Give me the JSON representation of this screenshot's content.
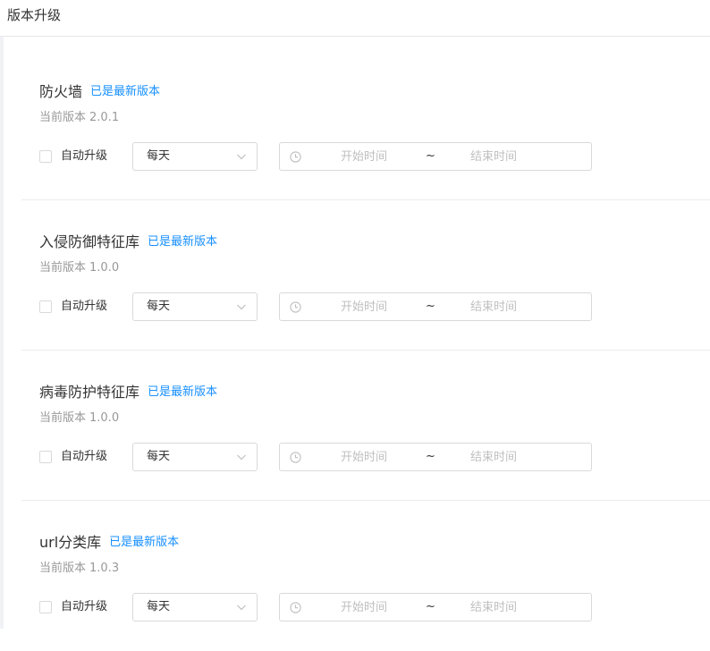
{
  "page": {
    "title": "版本升级"
  },
  "sections": [
    {
      "title": "防火墙",
      "status": "已是最新版本",
      "version_label": "当前版本",
      "version": "2.0.1",
      "auto_upgrade_label": "自动升级",
      "frequency": "每天",
      "start_placeholder": "开始时间",
      "separator": "~",
      "end_placeholder": "结束时间"
    },
    {
      "title": "入侵防御特征库",
      "status": "已是最新版本",
      "version_label": "当前版本",
      "version": "1.0.0",
      "auto_upgrade_label": "自动升级",
      "frequency": "每天",
      "start_placeholder": "开始时间",
      "separator": "~",
      "end_placeholder": "结束时间"
    },
    {
      "title": "病毒防护特征库",
      "status": "已是最新版本",
      "version_label": "当前版本",
      "version": "1.0.0",
      "auto_upgrade_label": "自动升级",
      "frequency": "每天",
      "start_placeholder": "开始时间",
      "separator": "~",
      "end_placeholder": "结束时间"
    },
    {
      "title": "url分类库",
      "status": "已是最新版本",
      "version_label": "当前版本",
      "version": "1.0.3",
      "auto_upgrade_label": "自动升级",
      "frequency": "每天",
      "start_placeholder": "开始时间",
      "separator": "~",
      "end_placeholder": "结束时间"
    }
  ],
  "icons": {
    "dropdown": "chevron-down-icon",
    "time": "clock-icon"
  },
  "colors": {
    "status": "#1890ff",
    "border": "#d9d9d9",
    "muted_text": "#999999",
    "placeholder": "#bfbfbf"
  }
}
